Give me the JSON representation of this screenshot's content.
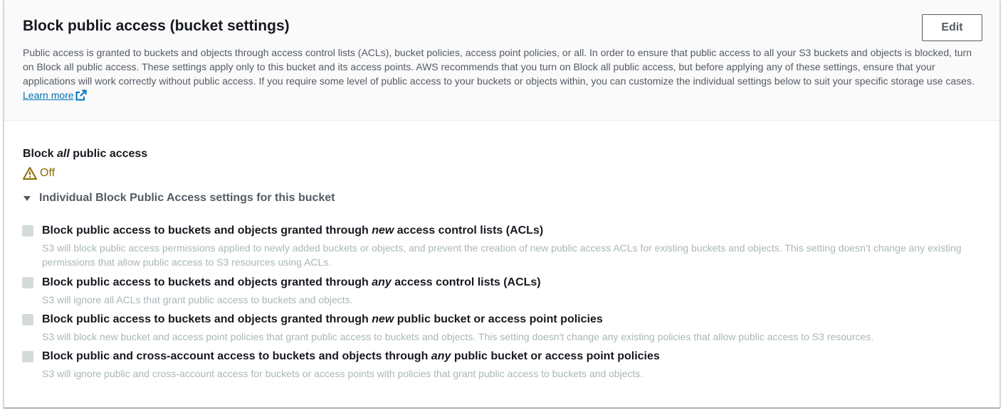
{
  "header": {
    "title": "Block public access (bucket settings)",
    "edit_label": "Edit",
    "description": "Public access is granted to buckets and objects through access control lists (ACLs), bucket policies, access point policies, or all. In order to ensure that public access to all your S3 buckets and objects is blocked, turn on Block all public access. These settings apply only to this bucket and its access points. AWS recommends that you turn on Block all public access, but before applying any of these settings, ensure that your applications will work correctly without public access. If you require some level of public access to your buckets or objects within, you can customize the individual settings below to suit your specific storage use cases.",
    "learn_more": "Learn more",
    "learn_more_icon": "external-link-icon"
  },
  "block_all": {
    "label_prefix": "Block ",
    "label_em": "all",
    "label_suffix": " public access",
    "status_icon": "warning-icon",
    "status": "Off",
    "status_color": "#8a6d00"
  },
  "individual": {
    "expander_label": "Individual Block Public Access settings for this bucket",
    "expanded": true,
    "settings": [
      {
        "title_prefix": "Block public access to buckets and objects granted through ",
        "title_em": "new",
        "title_suffix": " access control lists (ACLs)",
        "checked": false,
        "description": "S3 will block public access permissions applied to newly added buckets or objects, and prevent the creation of new public access ACLs for existing buckets and objects. This setting doesn’t change any existing permissions that allow public access to S3 resources using ACLs."
      },
      {
        "title_prefix": "Block public access to buckets and objects granted through ",
        "title_em": "any",
        "title_suffix": " access control lists (ACLs)",
        "checked": false,
        "description": "S3 will ignore all ACLs that grant public access to buckets and objects."
      },
      {
        "title_prefix": "Block public access to buckets and objects granted through ",
        "title_em": "new",
        "title_suffix": " public bucket or access point policies",
        "checked": false,
        "description": "S3 will block new bucket and access point policies that grant public access to buckets and objects. This setting doesn't change any existing policies that allow public access to S3 resources."
      },
      {
        "title_prefix": "Block public and cross-account access to buckets and objects through ",
        "title_em": "any",
        "title_suffix": " public bucket or access point policies",
        "checked": false,
        "description": "S3 will ignore public and cross-account access for buckets or access points with policies that grant public access to buckets and objects."
      }
    ]
  },
  "colors": {
    "link": "#0073bb",
    "title_text": "#16191f",
    "secondary_text": "#545b64",
    "disabled_text": "#aab7b8",
    "header_bg": "#fafafa"
  }
}
